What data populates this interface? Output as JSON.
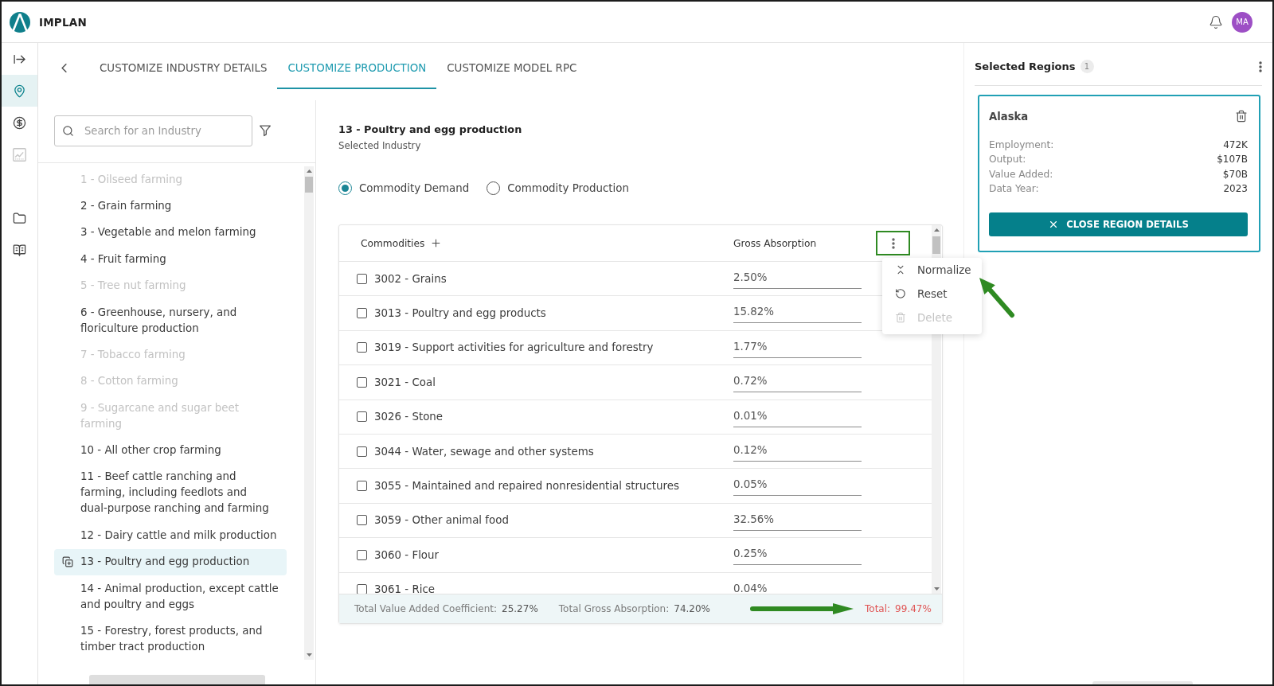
{
  "app": {
    "name": "IMPLAN",
    "avatar": "MA"
  },
  "nav_rail": {
    "top": [
      {
        "kind": "collapse",
        "selected": false,
        "disabled": false
      },
      {
        "kind": "location",
        "selected": true,
        "disabled": false
      },
      {
        "kind": "dollar",
        "selected": false,
        "disabled": false
      },
      {
        "kind": "chart",
        "selected": false,
        "disabled": true
      }
    ],
    "bottom": [
      {
        "kind": "folder",
        "selected": false,
        "disabled": false
      },
      {
        "kind": "book",
        "selected": false,
        "disabled": false
      }
    ]
  },
  "tabs": [
    {
      "label": "CUSTOMIZE INDUSTRY DETAILS",
      "selected": false
    },
    {
      "label": "CUSTOMIZE PRODUCTION",
      "selected": true
    },
    {
      "label": "CUSTOMIZE MODEL RPC",
      "selected": false
    }
  ],
  "industry_search": {
    "placeholder": "Search for an Industry"
  },
  "industries": [
    {
      "label": "1 - Oilseed farming",
      "disabled": true,
      "selected": false
    },
    {
      "label": "2 - Grain farming",
      "disabled": false,
      "selected": false
    },
    {
      "label": "3 - Vegetable and melon farming",
      "disabled": false,
      "selected": false
    },
    {
      "label": "4 - Fruit farming",
      "disabled": false,
      "selected": false
    },
    {
      "label": "5 - Tree nut farming",
      "disabled": true,
      "selected": false
    },
    {
      "label": "6 - Greenhouse, nursery, and\nfloriculture production",
      "disabled": false,
      "selected": false
    },
    {
      "label": "7 - Tobacco farming",
      "disabled": true,
      "selected": false
    },
    {
      "label": "8 - Cotton farming",
      "disabled": true,
      "selected": false
    },
    {
      "label": "9 - Sugarcane and sugar beet\nfarming",
      "disabled": true,
      "selected": false
    },
    {
      "label": "10 - All other crop farming",
      "disabled": false,
      "selected": false
    },
    {
      "label": "11 - Beef cattle ranching and\nfarming, including feedlots and\ndual-purpose ranching and farming",
      "disabled": false,
      "selected": false
    },
    {
      "label": "12 - Dairy cattle and milk production",
      "disabled": false,
      "selected": false
    },
    {
      "label": "13 - Poultry and egg production",
      "disabled": false,
      "selected": true
    },
    {
      "label": "14 - Animal production, except cattle\nand poultry and eggs",
      "disabled": false,
      "selected": false
    },
    {
      "label": "15 - Forestry, forest products, and\ntimber tract production",
      "disabled": false,
      "selected": false
    }
  ],
  "selected_industry": {
    "title": "13 - Poultry and egg production",
    "subtitle": "Selected Industry"
  },
  "view_options": [
    {
      "label": "Commodity Demand",
      "selected": true
    },
    {
      "label": "Commodity Production",
      "selected": false
    }
  ],
  "commodities_table": {
    "columns": [
      "Commodities",
      "Gross Absorption"
    ],
    "menu_button": {
      "highlighted": true
    },
    "rows": [
      {
        "name": "3002 - Grains",
        "value": "2.50%",
        "checked": false
      },
      {
        "name": "3013 - Poultry and egg products",
        "value": "15.82%",
        "checked": false
      },
      {
        "name": "3019 - Support activities for agriculture and forestry",
        "value": "1.77%",
        "checked": false
      },
      {
        "name": "3021 - Coal",
        "value": "0.72%",
        "checked": false
      },
      {
        "name": "3026 - Stone",
        "value": "0.01%",
        "checked": false
      },
      {
        "name": "3044 - Water, sewage and other systems",
        "value": "0.12%",
        "checked": false
      },
      {
        "name": "3055 - Maintained and repaired nonresidential structures",
        "value": "0.05%",
        "checked": false
      },
      {
        "name": "3059 - Other animal food",
        "value": "32.56%",
        "checked": false
      },
      {
        "name": "3060 - Flour",
        "value": "0.25%",
        "checked": false
      },
      {
        "name": "3061 - Rice",
        "value": "0.04%",
        "checked": false
      }
    ],
    "footer": [
      {
        "label": "Total Value Added Coefficient:",
        "value": "25.27%",
        "kind": "plain"
      },
      {
        "label": "Total Gross Absorption:",
        "value": "74.20%",
        "kind": "plain"
      },
      {
        "label": "Total:",
        "value": "99.47%",
        "kind": "alert"
      }
    ]
  },
  "column_menu": {
    "items": [
      {
        "label": "Normalize",
        "kind": "normalize",
        "disabled": false
      },
      {
        "label": "Reset",
        "kind": "reset",
        "disabled": false
      },
      {
        "label": "Delete",
        "kind": "delete",
        "disabled": true
      }
    ]
  },
  "selected_regions": {
    "title": "Selected Regions",
    "count": "1",
    "regions": [
      {
        "name": "Alaska",
        "stats": [
          {
            "label": "Employment:",
            "value": "472K"
          },
          {
            "label": "Output:",
            "value": "$107B"
          },
          {
            "label": "Value Added:",
            "value": "$70B"
          },
          {
            "label": "Data Year:",
            "value": "2023"
          }
        ],
        "button": "CLOSE REGION DETAILS"
      }
    ]
  }
}
